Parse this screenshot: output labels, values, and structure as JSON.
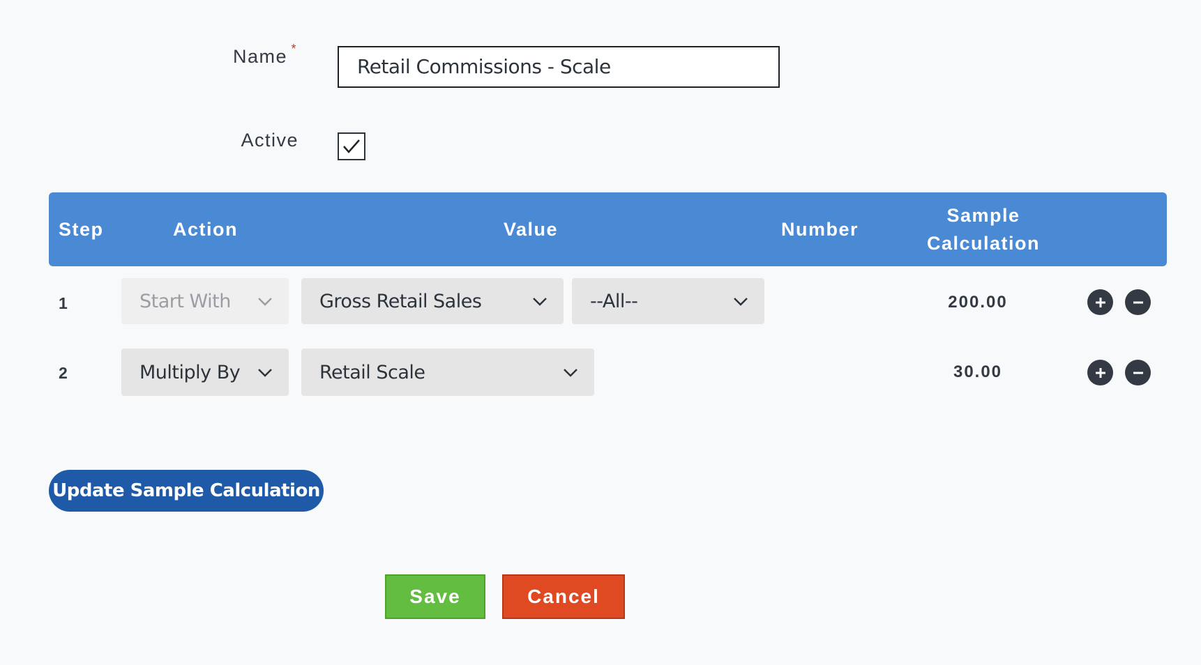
{
  "form": {
    "name_label": "Name",
    "required_marker": "*",
    "name_value": "Retail Commissions - Scale",
    "active_label": "Active",
    "active_checked": true
  },
  "table": {
    "headers": {
      "step": "Step",
      "action": "Action",
      "value": "Value",
      "number": "Number",
      "sample_line1": "Sample",
      "sample_line2": "Calculation"
    },
    "rows": [
      {
        "step": "1",
        "action": "Start With",
        "action_disabled": true,
        "value": "Gross Retail Sales",
        "filter": "--All--",
        "sample": "200.00"
      },
      {
        "step": "2",
        "action": "Multiply By",
        "action_disabled": false,
        "value": "Retail Scale",
        "sample": "30.00"
      }
    ]
  },
  "buttons": {
    "update": "Update Sample Calculation",
    "save": "Save",
    "cancel": "Cancel"
  },
  "icons": {
    "add": "plus-circle-icon",
    "remove": "minus-circle-icon",
    "dropdown": "chevron-down-icon",
    "check": "checkmark-icon"
  },
  "colors": {
    "header_blue": "#4a89d4",
    "update_blue": "#1e5aa8",
    "save_green": "#62bd40",
    "cancel_red": "#e04a22"
  }
}
